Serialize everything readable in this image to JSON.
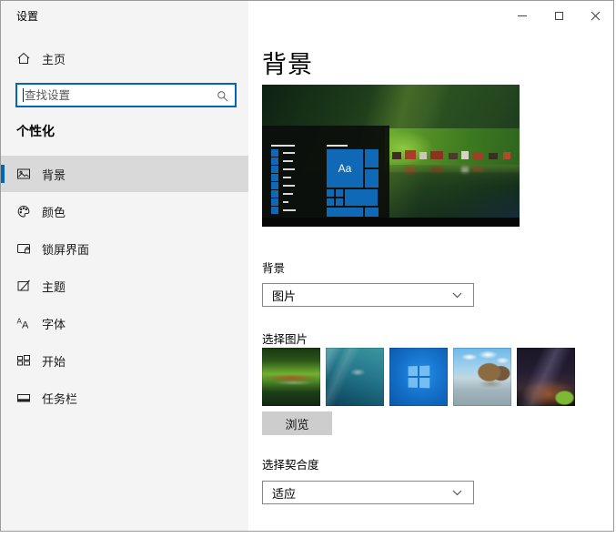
{
  "window": {
    "title": "设置"
  },
  "titlebar": {
    "minimize_icon": "minimize-icon",
    "maximize_icon": "maximize-icon",
    "close_icon": "close-icon"
  },
  "sidebar": {
    "home_label": "主页",
    "search_placeholder": "查找设置",
    "search_icon": "search-icon",
    "section_title": "个性化",
    "items": [
      {
        "label": "背景",
        "icon": "picture-icon",
        "selected": true
      },
      {
        "label": "颜色",
        "icon": "palette-icon",
        "selected": false
      },
      {
        "label": "锁屏界面",
        "icon": "lock-screen-icon",
        "selected": false
      },
      {
        "label": "主题",
        "icon": "theme-icon",
        "selected": false
      },
      {
        "label": "字体",
        "icon": "fonts-icon",
        "selected": false
      },
      {
        "label": "开始",
        "icon": "start-icon",
        "selected": false
      },
      {
        "label": "任务栏",
        "icon": "taskbar-icon",
        "selected": false
      }
    ]
  },
  "main": {
    "title": "背景",
    "preview": {
      "tile_label": "Aa",
      "content": "fjord-village-wallpaper-with-start-menu-overlay"
    },
    "background_section": {
      "label": "背景",
      "selected_value": "图片"
    },
    "choose_picture_label": "选择图片",
    "thumbnails": [
      "fjord-wallpaper",
      "underwater-wallpaper",
      "windows-default-wallpaper",
      "beach-wallpaper",
      "night-sky-wallpaper"
    ],
    "browse_label": "浏览",
    "fit_section": {
      "label": "选择契合度",
      "selected_value": "适应"
    }
  },
  "colors": {
    "accent": "#0067b8",
    "tile_blue": "#0f69b6",
    "selected_nav_bg": "#d9d9d9",
    "sidebar_bg": "#f4f4f4",
    "browse_button_bg": "#cdcdcd"
  }
}
